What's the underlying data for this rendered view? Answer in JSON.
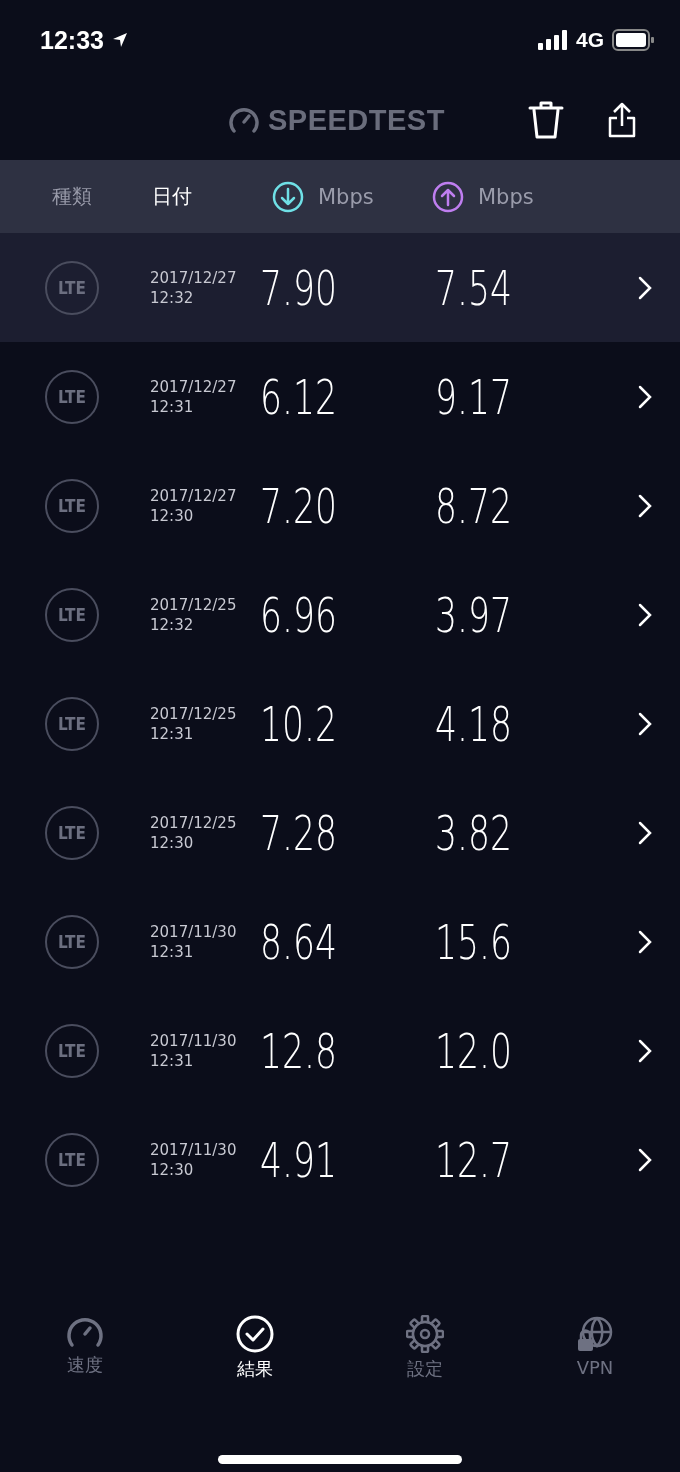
{
  "status_bar": {
    "time": "12:33",
    "network": "4G"
  },
  "header": {
    "logo": "SPEEDTEST"
  },
  "columns": [
    {
      "label": "種類",
      "selected": false
    },
    {
      "label": "日付",
      "selected": true
    },
    {
      "label": "Mbps",
      "kind": "download"
    },
    {
      "label": "Mbps",
      "kind": "upload"
    }
  ],
  "rows": [
    {
      "type": "LTE",
      "date": "2017/12/27",
      "time": "12:32",
      "download": "7.90",
      "upload": "7.54",
      "selected": true
    },
    {
      "type": "LTE",
      "date": "2017/12/27",
      "time": "12:31",
      "download": "6.12",
      "upload": "9.17",
      "selected": false
    },
    {
      "type": "LTE",
      "date": "2017/12/27",
      "time": "12:30",
      "download": "7.20",
      "upload": "8.72",
      "selected": false
    },
    {
      "type": "LTE",
      "date": "2017/12/25",
      "time": "12:32",
      "download": "6.96",
      "upload": "3.97",
      "selected": false
    },
    {
      "type": "LTE",
      "date": "2017/12/25",
      "time": "12:31",
      "download": "10.2",
      "upload": "4.18",
      "selected": false
    },
    {
      "type": "LTE",
      "date": "2017/12/25",
      "time": "12:30",
      "download": "7.28",
      "upload": "3.82",
      "selected": false
    },
    {
      "type": "LTE",
      "date": "2017/11/30",
      "time": "12:31",
      "download": "8.64",
      "upload": "15.6",
      "selected": false
    },
    {
      "type": "LTE",
      "date": "2017/11/30",
      "time": "12:31",
      "download": "12.8",
      "upload": "12.0",
      "selected": false
    },
    {
      "type": "LTE",
      "date": "2017/11/30",
      "time": "12:30",
      "download": "4.91",
      "upload": "12.7",
      "selected": false
    }
  ],
  "tabs": [
    {
      "label": "速度",
      "kind": "speed",
      "selected": false
    },
    {
      "label": "結果",
      "kind": "results",
      "selected": true
    },
    {
      "label": "設定",
      "kind": "settings",
      "selected": false
    },
    {
      "label": "VPN",
      "kind": "vpn",
      "selected": false
    }
  ]
}
